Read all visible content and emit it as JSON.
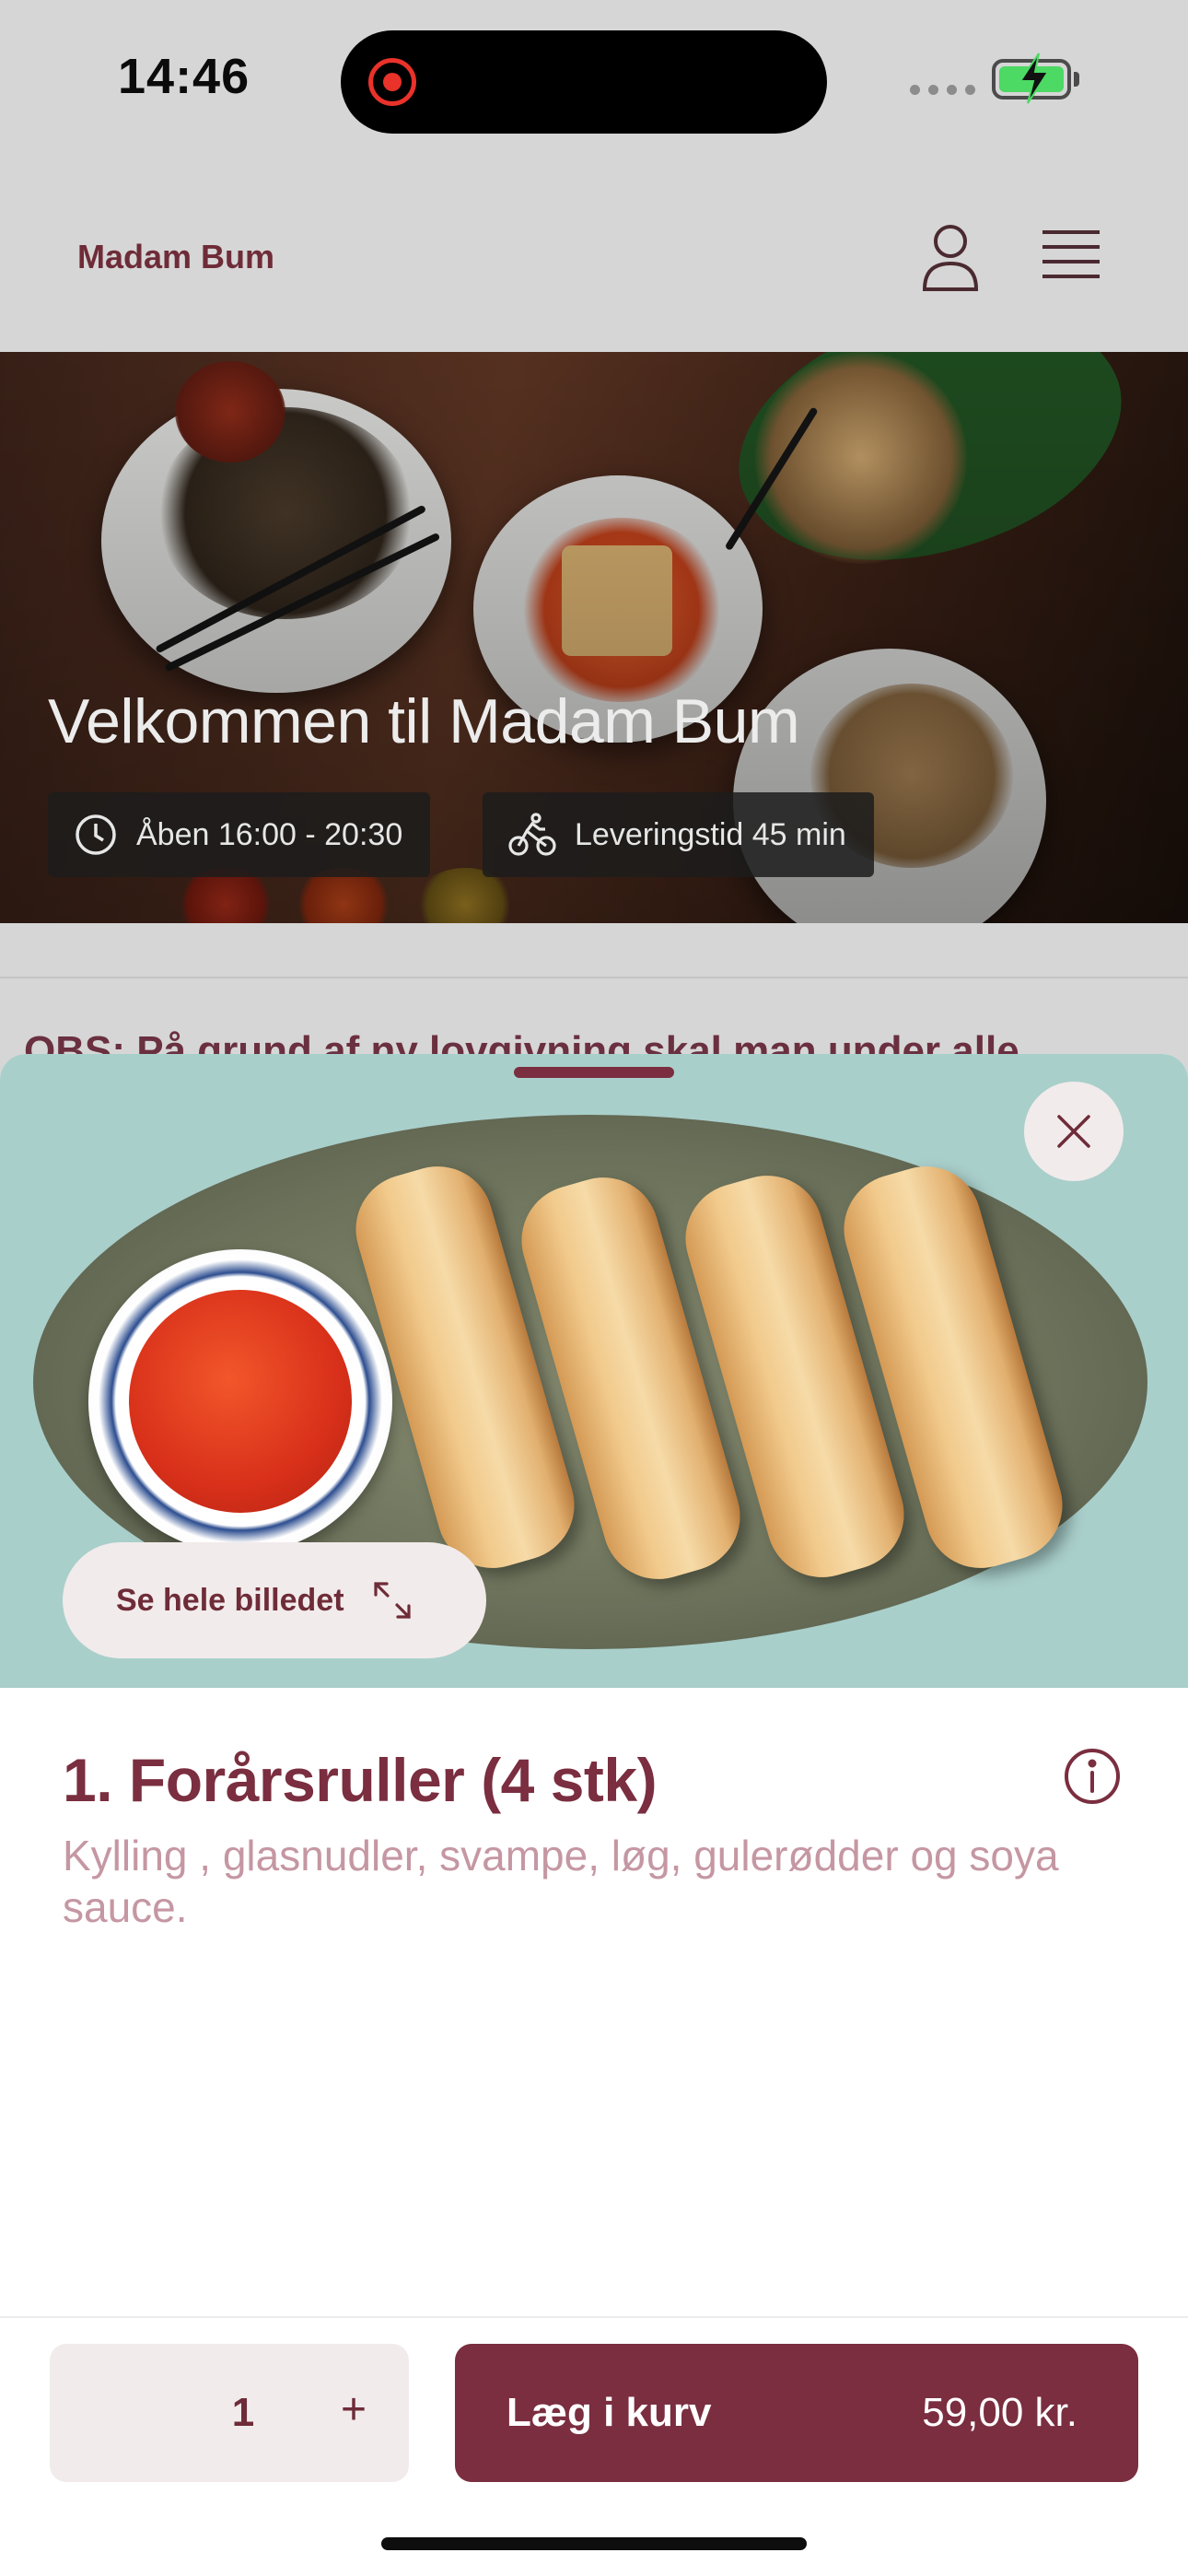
{
  "status_bar": {
    "time": "14:46"
  },
  "header": {
    "brand": "Madam Bum"
  },
  "hero": {
    "title": "Velkommen til Madam Bum",
    "opening_hours": "Åben 16:00 - 20:30",
    "delivery_time": "Leveringstid 45 min"
  },
  "notice": {
    "text": "OBS: På grund af ny lovgivning skal man under alle"
  },
  "sheet": {
    "see_image_label": "Se hele billedet",
    "item_title": "1. Forårsruller (4 stk)",
    "item_description": "Kylling , glasnudler, svampe, løg, gulerødder og soya sauce.",
    "quantity": "1",
    "plus_label": "+",
    "add_to_cart_label": "Læg i kurv",
    "price": "59,00 kr."
  },
  "colors": {
    "brand": "#7a2e3f",
    "button_light": "#f2ebeb",
    "description": "#c597a3",
    "battery": "#4cd964"
  }
}
